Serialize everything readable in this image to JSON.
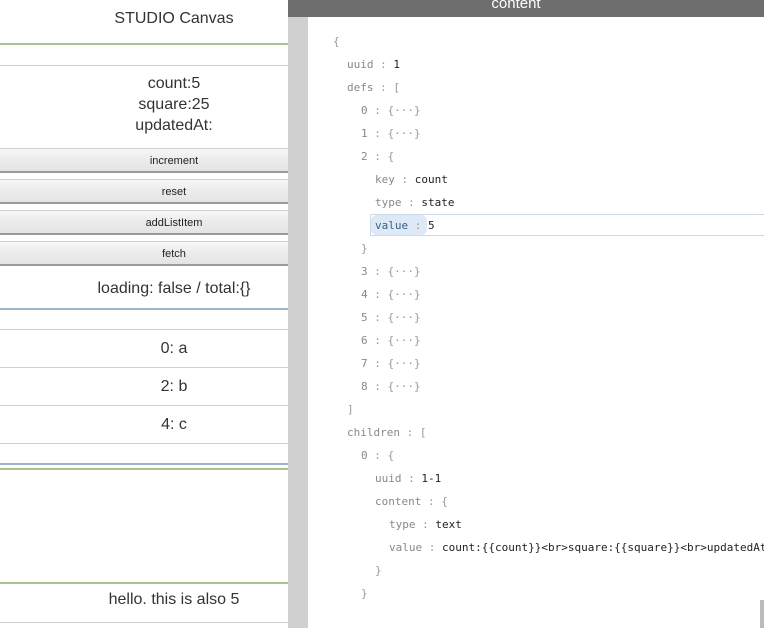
{
  "canvas": {
    "title": "STUDIO Canvas",
    "stats": [
      "count:5",
      "square:25",
      "updatedAt:"
    ],
    "buttons": [
      "increment",
      "reset",
      "addListItem",
      "fetch"
    ],
    "loading_text": "loading: false / total:{}",
    "list": [
      "0: a",
      "2: b",
      "4: c"
    ],
    "footer_text": "hello. this is also 5"
  },
  "inspector": {
    "title": "content",
    "rows": [
      {
        "indent": 0,
        "key": "",
        "value": "{"
      },
      {
        "indent": 1,
        "key": "uuid",
        "value": "1"
      },
      {
        "indent": 1,
        "key": "defs",
        "value": "["
      },
      {
        "indent": 2,
        "key": "0",
        "value": "{···}"
      },
      {
        "indent": 2,
        "key": "1",
        "value": "{···}"
      },
      {
        "indent": 2,
        "key": "2",
        "value": "{"
      },
      {
        "indent": 3,
        "key": "key",
        "value": "count"
      },
      {
        "indent": 3,
        "key": "type",
        "value": "state"
      },
      {
        "indent": 3,
        "key": "value",
        "value": "5",
        "selected": true
      },
      {
        "indent": 2,
        "key": "",
        "value": "}"
      },
      {
        "indent": 2,
        "key": "3",
        "value": "{···}"
      },
      {
        "indent": 2,
        "key": "4",
        "value": "{···}"
      },
      {
        "indent": 2,
        "key": "5",
        "value": "{···}"
      },
      {
        "indent": 2,
        "key": "6",
        "value": "{···}"
      },
      {
        "indent": 2,
        "key": "7",
        "value": "{···}"
      },
      {
        "indent": 2,
        "key": "8",
        "value": "{···}"
      },
      {
        "indent": 1,
        "key": "",
        "value": "]"
      },
      {
        "indent": 1,
        "key": "children",
        "value": "["
      },
      {
        "indent": 2,
        "key": "0",
        "value": "{"
      },
      {
        "indent": 3,
        "key": "uuid",
        "value": "1-1"
      },
      {
        "indent": 3,
        "key": "content",
        "value": "{"
      },
      {
        "indent": 4,
        "key": "type",
        "value": "text"
      },
      {
        "indent": 4,
        "key": "value",
        "value": "count:{{count}}<br>square:{{square}}<br>updatedAt:{{updatedAt}}"
      },
      {
        "indent": 3,
        "key": "",
        "value": "}"
      },
      {
        "indent": 2,
        "key": "",
        "value": "}"
      }
    ]
  }
}
